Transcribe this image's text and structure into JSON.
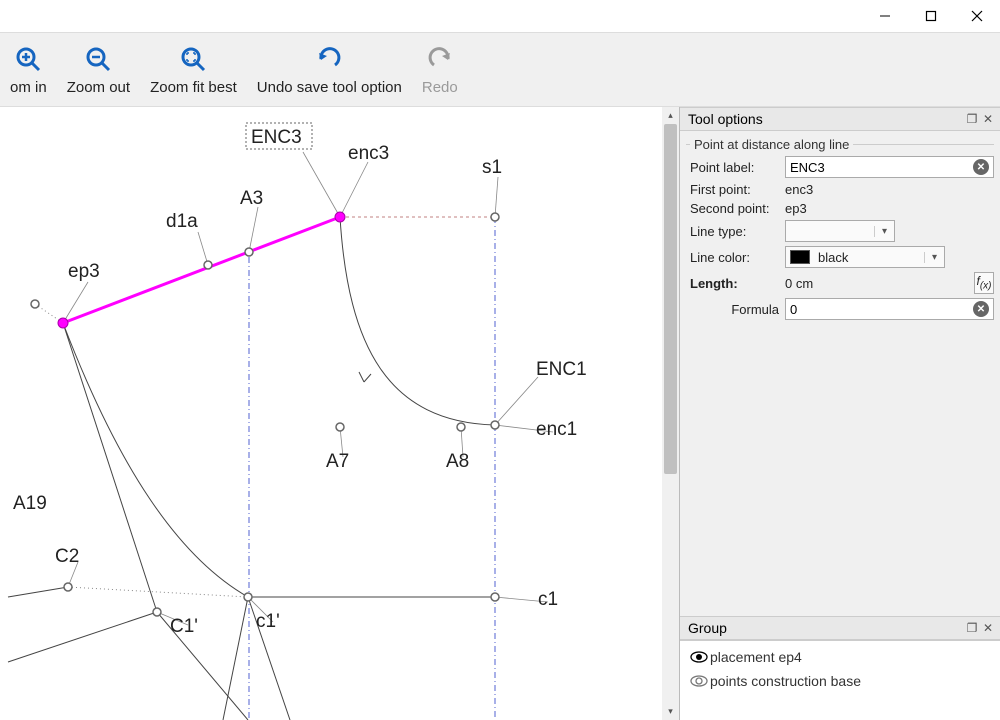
{
  "toolbar": {
    "zoom_in": "om in",
    "zoom_out": "Zoom out",
    "zoom_fit": "Zoom fit best",
    "undo": "Undo save tool option",
    "redo": "Redo"
  },
  "tool_options": {
    "panel_title": "Tool options",
    "section_title": "Point at distance along line",
    "point_label_label": "Point label:",
    "point_label_value": "ENC3",
    "first_point_label": "First point:",
    "first_point_value": "enc3",
    "second_point_label": "Second point:",
    "second_point_value": "ep3",
    "line_type_label": "Line type:",
    "line_type_value": "",
    "line_color_label": "Line color:",
    "line_color_value": "black",
    "length_label": "Length:",
    "length_value": "0 cm",
    "formula_label": "Formula",
    "formula_value": "0"
  },
  "group": {
    "panel_title": "Group",
    "items": [
      {
        "label": "placement ep4",
        "visible": true
      },
      {
        "label": "points construction base",
        "visible": true
      }
    ]
  },
  "canvas": {
    "labels": {
      "ENC3": "ENC3",
      "enc3": "enc3",
      "s1": "s1",
      "A3": "A3",
      "d1a": "d1a",
      "ep3": "ep3",
      "A19": "A19",
      "C2": "C2",
      "C1p": "C1'",
      "c1p": "c1'",
      "A7": "A7",
      "A8": "A8",
      "ENC1": "ENC1",
      "enc1": "enc1",
      "c1": "c1"
    }
  }
}
